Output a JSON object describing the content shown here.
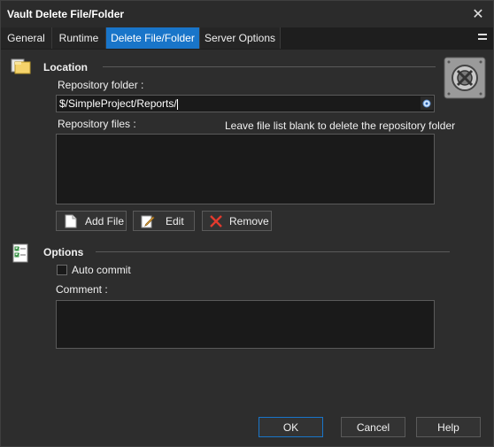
{
  "window": {
    "title": "Vault Delete File/Folder",
    "close_glyph": "✕"
  },
  "tabs": [
    {
      "label": "General"
    },
    {
      "label": "Runtime"
    },
    {
      "label": "Delete File/Folder",
      "active": true
    },
    {
      "label": "Server Options"
    }
  ],
  "location": {
    "title": "Location",
    "repo_folder_label": "Repository folder :",
    "repo_folder_value": "$/SimpleProject/Reports/",
    "repo_files_label": "Repository files :",
    "hint": "Leave file list blank to delete the repository folder",
    "add_file_label": "Add File",
    "edit_label": "Edit",
    "remove_label": "Remove"
  },
  "options": {
    "title": "Options",
    "auto_commit_label": "Auto commit",
    "auto_commit_checked": false,
    "comment_label": "Comment :",
    "comment_value": ""
  },
  "footer": {
    "ok_label": "OK",
    "cancel_label": "Cancel",
    "help_label": "Help"
  },
  "colors": {
    "accent": "#1975c9",
    "background": "#2d2d2d",
    "field": "#1a1a1a"
  }
}
